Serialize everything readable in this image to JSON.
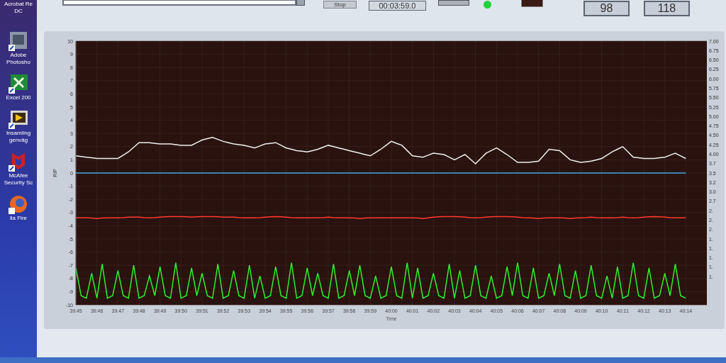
{
  "desktop_icons": [
    {
      "kind": "acrobat",
      "label": "Acrobat Re\nDC"
    },
    {
      "kind": "photoshop",
      "label": "Adobe\nPhotosho"
    },
    {
      "kind": "excel",
      "label": "Excel 200"
    },
    {
      "kind": "labview",
      "label": "Insamling\ngenväg"
    },
    {
      "kind": "mcafee",
      "label": "McAfee\nSecurity Sc"
    },
    {
      "kind": "firefox",
      "label": "lla Fire"
    }
  ],
  "toolbar": {
    "stop_button": "Stop",
    "elapsed_time": "00:03:59.0",
    "led": {
      "on": true
    },
    "readouts": [
      "98",
      "118"
    ]
  },
  "chart": {
    "y2_ticks": [
      "7.00",
      "6.75",
      "6.50",
      "6.25",
      "6.00",
      "5.75",
      "5.50",
      "5.25",
      "5.00",
      "4.75",
      "4.50",
      "4.25",
      "4.00",
      "3.7",
      "3.5",
      "3.2",
      "3.0",
      "2.7",
      "2.",
      "2.",
      "2.",
      "1.",
      "1.",
      "1.",
      "1.",
      "1."
    ],
    "chart_data": {
      "type": "line",
      "grid": true,
      "xlabel": "Time",
      "ylabel": "RIP",
      "xlim": [
        2385,
        2415
      ],
      "ylim": [
        -10,
        10
      ],
      "yticks": [
        -10,
        -9,
        -8,
        -7,
        -6,
        -5,
        -4,
        -3,
        -2,
        -1,
        0,
        1,
        2,
        3,
        4,
        5,
        6,
        7,
        8,
        9,
        10
      ],
      "xticks": [
        {
          "value": 2385,
          "label": "39:45"
        },
        {
          "value": 2386,
          "label": "39:46"
        },
        {
          "value": 2387,
          "label": "39:47"
        },
        {
          "value": 2388,
          "label": "39:48"
        },
        {
          "value": 2389,
          "label": "39:49"
        },
        {
          "value": 2390,
          "label": "39:50"
        },
        {
          "value": 2391,
          "label": "39:51"
        },
        {
          "value": 2392,
          "label": "39:52"
        },
        {
          "value": 2393,
          "label": "39:53"
        },
        {
          "value": 2394,
          "label": "39:54"
        },
        {
          "value": 2395,
          "label": "39:55"
        },
        {
          "value": 2396,
          "label": "39:56"
        },
        {
          "value": 2397,
          "label": "39:57"
        },
        {
          "value": 2398,
          "label": "39:58"
        },
        {
          "value": 2399,
          "label": "39:59"
        },
        {
          "value": 2400,
          "label": "40:00"
        },
        {
          "value": 2401,
          "label": "40:01"
        },
        {
          "value": 2402,
          "label": "40:02"
        },
        {
          "value": 2403,
          "label": "40:03"
        },
        {
          "value": 2404,
          "label": "40:04"
        },
        {
          "value": 2405,
          "label": "40:05"
        },
        {
          "value": 2406,
          "label": "40:06"
        },
        {
          "value": 2407,
          "label": "40:07"
        },
        {
          "value": 2408,
          "label": "40:08"
        },
        {
          "value": 2409,
          "label": "40:09"
        },
        {
          "value": 2410,
          "label": "40:10"
        },
        {
          "value": 2411,
          "label": "40:11"
        },
        {
          "value": 2412,
          "label": "40:12"
        },
        {
          "value": 2413,
          "label": "40:13"
        },
        {
          "value": 2414,
          "label": "40:14"
        }
      ],
      "x": [
        2385,
        2385.25,
        2385.5,
        2385.75,
        2386,
        2386.25,
        2386.5,
        2386.75,
        2387,
        2387.25,
        2387.5,
        2387.75,
        2388,
        2388.25,
        2388.5,
        2388.75,
        2389,
        2389.25,
        2389.5,
        2389.75,
        2390,
        2390.25,
        2390.5,
        2390.75,
        2391,
        2391.25,
        2391.5,
        2391.75,
        2392,
        2392.25,
        2392.5,
        2392.75,
        2393,
        2393.25,
        2393.5,
        2393.75,
        2394,
        2394.25,
        2394.5,
        2394.75,
        2395,
        2395.25,
        2395.5,
        2395.75,
        2396,
        2396.25,
        2396.5,
        2396.75,
        2397,
        2397.25,
        2397.5,
        2397.75,
        2398,
        2398.25,
        2398.5,
        2398.75,
        2399,
        2399.25,
        2399.5,
        2399.75,
        2400,
        2400.25,
        2400.5,
        2400.75,
        2401,
        2401.25,
        2401.5,
        2401.75,
        2402,
        2402.25,
        2402.5,
        2402.75,
        2403,
        2403.25,
        2403.5,
        2403.75,
        2404,
        2404.25,
        2404.5,
        2404.75,
        2405,
        2405.25,
        2405.5,
        2405.75,
        2406,
        2406.25,
        2406.5,
        2406.75,
        2407,
        2407.25,
        2407.5,
        2407.75,
        2408,
        2408.25,
        2408.5,
        2408.75,
        2409,
        2409.25,
        2409.5,
        2409.75,
        2410,
        2410.25,
        2410.5,
        2410.75,
        2411,
        2411.25,
        2411.5,
        2411.75,
        2412,
        2412.25,
        2412.5,
        2412.75,
        2413,
        2413.25,
        2413.5,
        2413.75,
        2414
      ],
      "series": [
        {
          "color": "#f0f0f0",
          "values": [
            1.3,
            1.25,
            1.2,
            1.15,
            1.1,
            1.1,
            1.1,
            1.1,
            1.1,
            1.35,
            1.6,
            1.95,
            2.3,
            2.3,
            2.3,
            2.25,
            2.2,
            2.2,
            2.2,
            2.15,
            2.1,
            2.1,
            2.1,
            2.3,
            2.5,
            2.6,
            2.7,
            2.55,
            2.4,
            2.3,
            2.2,
            2.15,
            2.1,
            2.0,
            1.9,
            2.05,
            2.2,
            2.25,
            2.3,
            2.1,
            1.9,
            1.8,
            1.7,
            1.65,
            1.6,
            1.7,
            1.8,
            1.95,
            2.1,
            2.0,
            1.9,
            1.8,
            1.7,
            1.6,
            1.5,
            1.4,
            1.3,
            1.55,
            1.8,
            2.1,
            2.4,
            2.25,
            2.1,
            1.7,
            1.3,
            1.25,
            1.2,
            1.35,
            1.5,
            1.45,
            1.4,
            1.2,
            1.0,
            1.2,
            1.4,
            1.05,
            0.7,
            1.1,
            1.5,
            1.7,
            1.9,
            1.65,
            1.4,
            1.1,
            0.8,
            0.8,
            0.8,
            0.85,
            0.9,
            1.35,
            1.8,
            1.75,
            1.7,
            1.35,
            1.0,
            0.9,
            0.8,
            0.85,
            0.9,
            1.0,
            1.1,
            1.35,
            1.6,
            1.8,
            2.0,
            1.6,
            1.2,
            1.15,
            1.1,
            1.1,
            1.1,
            1.15,
            1.2,
            1.35,
            1.5,
            1.3,
            1.1
          ]
        },
        {
          "color": "#3fa8e0",
          "values": [
            0,
            0,
            0,
            0,
            0,
            0,
            0,
            0,
            0,
            0,
            0,
            0,
            0,
            0,
            0,
            0,
            0,
            0,
            0,
            0,
            0,
            0,
            0,
            0,
            0,
            0,
            0,
            0,
            0,
            0,
            0,
            0,
            0,
            0,
            0,
            0,
            0,
            0,
            0,
            0,
            0,
            0,
            0,
            0,
            0,
            0,
            0,
            0,
            0,
            0,
            0,
            0,
            0,
            0,
            0,
            0,
            0,
            0,
            0,
            0,
            0,
            0,
            0,
            0,
            0,
            0,
            0,
            0,
            0,
            0,
            0,
            0,
            0,
            0,
            0,
            0,
            0,
            0,
            0,
            0,
            0,
            0,
            0,
            0,
            0,
            0,
            0,
            0,
            0,
            0,
            0,
            0,
            0,
            0,
            0,
            0,
            0,
            0,
            0,
            0,
            0,
            0,
            0,
            0,
            0,
            0,
            0,
            0,
            0,
            0,
            0,
            0,
            0,
            0,
            0,
            0,
            0
          ]
        },
        {
          "color": "#ff3a2a",
          "values": [
            -3.4,
            -3.4,
            -3.4,
            -3.42,
            -3.45,
            -3.42,
            -3.4,
            -3.4,
            -3.4,
            -3.38,
            -3.35,
            -3.35,
            -3.35,
            -3.38,
            -3.4,
            -3.38,
            -3.35,
            -3.32,
            -3.3,
            -3.3,
            -3.3,
            -3.32,
            -3.35,
            -3.32,
            -3.3,
            -3.3,
            -3.3,
            -3.32,
            -3.35,
            -3.35,
            -3.35,
            -3.38,
            -3.4,
            -3.4,
            -3.4,
            -3.38,
            -3.35,
            -3.32,
            -3.3,
            -3.32,
            -3.35,
            -3.38,
            -3.4,
            -3.4,
            -3.4,
            -3.4,
            -3.4,
            -3.38,
            -3.35,
            -3.38,
            -3.4,
            -3.4,
            -3.4,
            -3.42,
            -3.45,
            -3.42,
            -3.4,
            -3.4,
            -3.4,
            -3.4,
            -3.4,
            -3.4,
            -3.4,
            -3.4,
            -3.4,
            -3.42,
            -3.45,
            -3.4,
            -3.35,
            -3.32,
            -3.3,
            -3.3,
            -3.3,
            -3.32,
            -3.35,
            -3.38,
            -3.4,
            -3.38,
            -3.35,
            -3.32,
            -3.3,
            -3.3,
            -3.3,
            -3.32,
            -3.35,
            -3.38,
            -3.4,
            -3.42,
            -3.45,
            -3.42,
            -3.4,
            -3.4,
            -3.4,
            -3.42,
            -3.45,
            -3.42,
            -3.4,
            -3.38,
            -3.35,
            -3.38,
            -3.4,
            -3.4,
            -3.4,
            -3.38,
            -3.35,
            -3.38,
            -3.4,
            -3.38,
            -3.35,
            -3.32,
            -3.3,
            -3.32,
            -3.35,
            -3.38,
            -3.4,
            -3.4,
            -3.4
          ]
        },
        {
          "color": "#2cf02c",
          "values": [
            -7.2,
            -9.3,
            -9.5,
            -7.6,
            -9.5,
            -6.9,
            -9.5,
            -9.3,
            -7.4,
            -9.3,
            -9.5,
            -7.0,
            -9.5,
            -9.3,
            -7.8,
            -9.3,
            -7.1,
            -9.3,
            -9.5,
            -6.8,
            -9.5,
            -9.3,
            -7.2,
            -9.3,
            -7.6,
            -9.3,
            -9.5,
            -6.9,
            -9.5,
            -9.3,
            -7.4,
            -9.3,
            -9.5,
            -7.0,
            -9.5,
            -7.8,
            -9.5,
            -9.3,
            -7.1,
            -9.3,
            -9.5,
            -6.8,
            -9.5,
            -9.3,
            -7.2,
            -9.3,
            -7.6,
            -9.3,
            -9.5,
            -6.9,
            -9.5,
            -9.3,
            -7.4,
            -9.3,
            -7.0,
            -9.3,
            -9.5,
            -7.8,
            -9.5,
            -9.3,
            -7.1,
            -9.3,
            -9.5,
            -6.8,
            -9.5,
            -7.2,
            -9.5,
            -9.3,
            -7.6,
            -9.3,
            -9.5,
            -6.9,
            -9.5,
            -7.4,
            -9.5,
            -9.3,
            -7.0,
            -9.3,
            -9.5,
            -7.8,
            -9.5,
            -9.3,
            -7.1,
            -9.3,
            -6.8,
            -9.3,
            -9.5,
            -7.2,
            -9.5,
            -9.3,
            -7.6,
            -9.3,
            -6.9,
            -9.3,
            -9.5,
            -7.4,
            -9.5,
            -9.3,
            -7.0,
            -9.3,
            -9.5,
            -7.8,
            -9.5,
            -7.1,
            -9.5,
            -9.3,
            -6.8,
            -9.3,
            -9.5,
            -7.2,
            -9.5,
            -9.3,
            -7.6,
            -9.3,
            -6.9,
            -9.3,
            -9.5
          ]
        }
      ]
    }
  }
}
